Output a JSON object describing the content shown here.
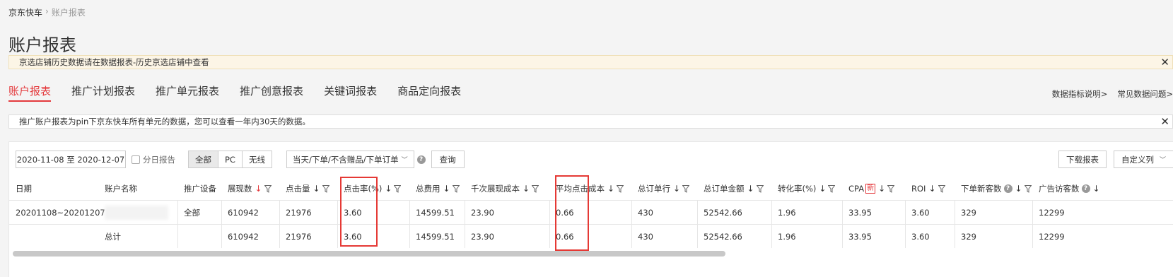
{
  "breadcrumb": {
    "root": "京东快车",
    "sep": "›",
    "current": "账户报表"
  },
  "page_title": "账户报表",
  "notice1": "京选店铺历史数据请在数据报表-历史京选店铺中查看",
  "tabs": [
    "账户报表",
    "推广计划报表",
    "推广单元报表",
    "推广创意报表",
    "关键词报表",
    "商品定向报表"
  ],
  "help_links": [
    "数据指标说明>",
    "常见数据问题>"
  ],
  "notice2": "推广账户报表为pin下京东快车所有单元的数据，您可以查看一年内30天的数据。",
  "toolbar": {
    "date_range": "2020-11-08 至 2020-12-07",
    "daily_report": "分日报告",
    "device_options": [
      "全部",
      "PC",
      "无线"
    ],
    "attribution": "当天/下单/不含赠品/下单订单",
    "query": "查询",
    "download": "下载报表",
    "custom_columns": "自定义列"
  },
  "columns": [
    "日期",
    "账户名称",
    "推广设备",
    "展现数",
    "点击量",
    "点击率(%)",
    "总费用",
    "千次展现成本",
    "平均点击成本",
    "总订单行",
    "总订单金额",
    "转化率(%)",
    "CPA",
    "ROI",
    "下单新客数",
    "广告访客数"
  ],
  "new_badge": "新",
  "rows": [
    [
      "20201108~20201207",
      "",
      "全部",
      "610942",
      "21976",
      "3.60",
      "14599.51",
      "23.90",
      "0.66",
      "430",
      "52542.66",
      "1.96",
      "33.95",
      "3.60",
      "329",
      "12299"
    ],
    [
      "",
      "总计",
      "",
      "610942",
      "21976",
      "3.60",
      "14599.51",
      "23.90",
      "0.66",
      "430",
      "52542.66",
      "1.96",
      "33.95",
      "3.60",
      "329",
      "12299"
    ]
  ],
  "colors": {
    "accent": "#e4393c",
    "highlight": "#e53935",
    "notice_bg": "#fcf5e6"
  }
}
